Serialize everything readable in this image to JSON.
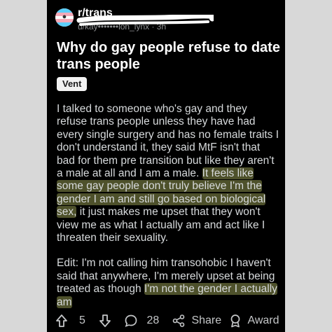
{
  "post": {
    "subreddit": "r/trans",
    "author_meta": "u/kay•••••••lon_lynx · 3h",
    "title": "Why do gay people refuse to date trans people",
    "flair": "Vent",
    "body": {
      "p1_a": "I talked to someone who's gay and they refuse trans people unless they have had every single surgery and has no female traits I don't understand it, they said MtF isn't that bad for them pre transition but like they aren't a male at all and I am a male. ",
      "p1_highlight": "It feels like some gay people don't truly believe I'm the gender I am and still go based on biological sex,",
      "p1_b": " it just makes me upset that they won't view me as what I actually am and act like I threaten their sexuality.",
      "p2_a": "Edit: I'm not calling him transohobic I haven't said that anywhere, I'm merely upset at being treated as though ",
      "p2_highlight": "I'm not the gender I actually am"
    }
  },
  "actions": {
    "upvote_icon": "arrow-up-icon",
    "vote_count": "5",
    "downvote_icon": "arrow-down-icon",
    "comment_icon": "comment-icon",
    "comment_count": "28",
    "share_icon": "share-icon",
    "share_label": "Share",
    "award_icon": "award-icon",
    "award_label": "Award"
  },
  "colors": {
    "card_bg": "#000000",
    "page_bg": "#d8d8d8",
    "highlight": "#ced470",
    "text": "#d7dadc"
  }
}
